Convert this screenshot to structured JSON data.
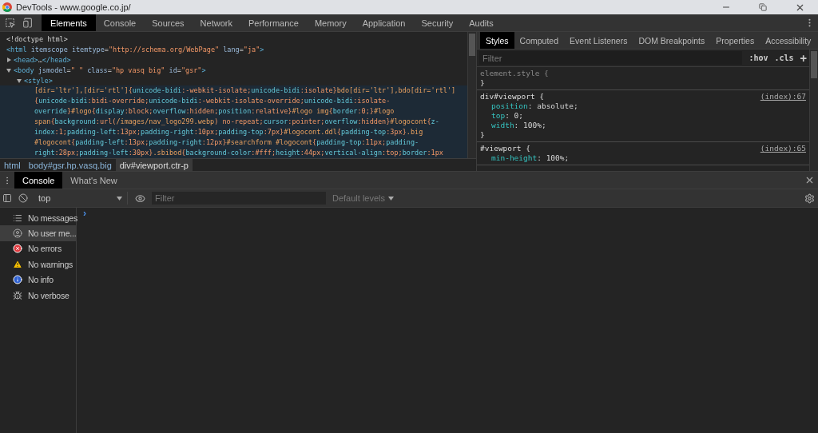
{
  "window": {
    "title": "DevTools - www.google.co.jp/"
  },
  "main_tabs": [
    {
      "label": "Elements",
      "selected": true
    },
    {
      "label": "Console",
      "selected": false
    },
    {
      "label": "Sources",
      "selected": false
    },
    {
      "label": "Network",
      "selected": false
    },
    {
      "label": "Performance",
      "selected": false
    },
    {
      "label": "Memory",
      "selected": false
    },
    {
      "label": "Application",
      "selected": false
    },
    {
      "label": "Security",
      "selected": false
    },
    {
      "label": "Audits",
      "selected": false
    }
  ],
  "dom_tree": [
    {
      "kind": "leaf",
      "segments": [
        {
          "kind": "text",
          "text": "<!doctype html>"
        }
      ]
    },
    {
      "kind": "leaf",
      "segments": [
        {
          "kind": "tag",
          "text": "<html"
        },
        {
          "kind": "attr",
          "text": " itemscope itemtype"
        },
        {
          "kind": "text",
          "text": "="
        },
        {
          "kind": "val",
          "text": "\"http://schema.org/WebPage\""
        },
        {
          "kind": "attr",
          "text": " lang"
        },
        {
          "kind": "text",
          "text": "="
        },
        {
          "kind": "val",
          "text": "\"ja\""
        },
        {
          "kind": "tag",
          "text": ">"
        }
      ]
    },
    {
      "kind": "node",
      "expanded": false,
      "segments": [
        {
          "kind": "tag",
          "text": "<head>"
        },
        {
          "kind": "text",
          "text": "…"
        },
        {
          "kind": "tag",
          "text": "</head>"
        }
      ]
    },
    {
      "kind": "node",
      "expanded": true,
      "segments": [
        {
          "kind": "tag",
          "text": "<body"
        },
        {
          "kind": "attr",
          "text": " jsmodel"
        },
        {
          "kind": "text",
          "text": "="
        },
        {
          "kind": "val",
          "text": "\" \""
        },
        {
          "kind": "attr",
          "text": " class"
        },
        {
          "kind": "text",
          "text": "="
        },
        {
          "kind": "val",
          "text": "\"hp vasq big\""
        },
        {
          "kind": "attr",
          "text": " id"
        },
        {
          "kind": "text",
          "text": "="
        },
        {
          "kind": "val",
          "text": "\"gsr\""
        },
        {
          "kind": "tag",
          "text": ">"
        }
      ],
      "children": [
        {
          "kind": "node",
          "expanded": true,
          "segments": [
            {
              "kind": "tag",
              "text": "<style>"
            }
          ],
          "children": [
            {
              "kind": "css",
              "segments": [
                {
                  "kind": "sel",
                  "text": "[dir='ltr'],[dir='rtl']"
                },
                {
                  "kind": "val",
                  "text": "{"
                },
                {
                  "kind": "prop",
                  "text": "unicode-bidi"
                },
                {
                  "kind": "val",
                  "text": ":-webkit-isolate;"
                },
                {
                  "kind": "prop",
                  "text": "unicode-bidi"
                },
                {
                  "kind": "val",
                  "text": ":isolate}"
                },
                {
                  "kind": "sel",
                  "text": "bdo[dir='ltr'],bdo[dir='rtl']"
                }
              ]
            },
            {
              "kind": "css",
              "segments": [
                {
                  "kind": "val",
                  "text": "{"
                },
                {
                  "kind": "prop",
                  "text": "unicode-bidi"
                },
                {
                  "kind": "val",
                  "text": ":bidi-override;"
                },
                {
                  "kind": "prop",
                  "text": "unicode-bidi"
                },
                {
                  "kind": "val",
                  "text": ":-webkit-isolate-override;"
                },
                {
                  "kind": "prop",
                  "text": "unicode-bidi"
                },
                {
                  "kind": "val",
                  "text": ":isolate-"
                }
              ]
            },
            {
              "kind": "css",
              "segments": [
                {
                  "kind": "prop",
                  "text": "override"
                },
                {
                  "kind": "val",
                  "text": "}"
                },
                {
                  "kind": "sel",
                  "text": "#logo"
                },
                {
                  "kind": "val",
                  "text": "{"
                },
                {
                  "kind": "prop",
                  "text": "display"
                },
                {
                  "kind": "val",
                  "text": ":block;"
                },
                {
                  "kind": "prop",
                  "text": "overflow"
                },
                {
                  "kind": "val",
                  "text": ":hidden;"
                },
                {
                  "kind": "prop",
                  "text": "position"
                },
                {
                  "kind": "val",
                  "text": ":relative}"
                },
                {
                  "kind": "sel",
                  "text": "#logo img"
                },
                {
                  "kind": "val",
                  "text": "{"
                },
                {
                  "kind": "prop",
                  "text": "border"
                },
                {
                  "kind": "val",
                  "text": ":0;}"
                },
                {
                  "kind": "sel",
                  "text": "#logo"
                }
              ]
            },
            {
              "kind": "css",
              "segments": [
                {
                  "kind": "sel",
                  "text": "span"
                },
                {
                  "kind": "val",
                  "text": "{"
                },
                {
                  "kind": "prop",
                  "text": "background"
                },
                {
                  "kind": "val",
                  "text": ":url("
                },
                {
                  "kind": "sel",
                  "text": "/images/nav_logo299.webp"
                },
                {
                  "kind": "val",
                  "text": ") no-repeat;"
                },
                {
                  "kind": "prop",
                  "text": "cursor"
                },
                {
                  "kind": "val",
                  "text": ":pointer;"
                },
                {
                  "kind": "prop",
                  "text": "overflow"
                },
                {
                  "kind": "val",
                  "text": ":hidden}"
                },
                {
                  "kind": "sel",
                  "text": "#logocont"
                },
                {
                  "kind": "val",
                  "text": "{"
                },
                {
                  "kind": "prop",
                  "text": "z-"
                }
              ]
            },
            {
              "kind": "css",
              "segments": [
                {
                  "kind": "prop",
                  "text": "index"
                },
                {
                  "kind": "val",
                  "text": ":1;"
                },
                {
                  "kind": "prop",
                  "text": "padding-left"
                },
                {
                  "kind": "val",
                  "text": ":13px;"
                },
                {
                  "kind": "prop",
                  "text": "padding-right"
                },
                {
                  "kind": "val",
                  "text": ":10px;"
                },
                {
                  "kind": "prop",
                  "text": "padding-top"
                },
                {
                  "kind": "val",
                  "text": ":7px}"
                },
                {
                  "kind": "sel",
                  "text": "#logocont.ddl"
                },
                {
                  "kind": "val",
                  "text": "{"
                },
                {
                  "kind": "prop",
                  "text": "padding-top"
                },
                {
                  "kind": "val",
                  "text": ":3px}"
                },
                {
                  "kind": "sel",
                  "text": ".big"
                }
              ]
            },
            {
              "kind": "css",
              "segments": [
                {
                  "kind": "sel",
                  "text": "#logocont"
                },
                {
                  "kind": "val",
                  "text": "{"
                },
                {
                  "kind": "prop",
                  "text": "padding-left"
                },
                {
                  "kind": "val",
                  "text": ":13px;"
                },
                {
                  "kind": "prop",
                  "text": "padding-right"
                },
                {
                  "kind": "val",
                  "text": ":12px}"
                },
                {
                  "kind": "sel",
                  "text": "#searchform #logocont"
                },
                {
                  "kind": "val",
                  "text": "{"
                },
                {
                  "kind": "prop",
                  "text": "padding-top"
                },
                {
                  "kind": "val",
                  "text": ":11px;"
                },
                {
                  "kind": "prop",
                  "text": "padding-"
                }
              ]
            },
            {
              "kind": "css",
              "segments": [
                {
                  "kind": "prop",
                  "text": "right"
                },
                {
                  "kind": "val",
                  "text": ":28px;"
                },
                {
                  "kind": "prop",
                  "text": "padding-left"
                },
                {
                  "kind": "val",
                  "text": ":30px}"
                },
                {
                  "kind": "sel",
                  "text": ".sbibod"
                },
                {
                  "kind": "val",
                  "text": "{"
                },
                {
                  "kind": "prop",
                  "text": "background-color"
                },
                {
                  "kind": "val",
                  "text": ":#fff;"
                },
                {
                  "kind": "prop",
                  "text": "height"
                },
                {
                  "kind": "val",
                  "text": ":44px;"
                },
                {
                  "kind": "prop",
                  "text": "vertical-align"
                },
                {
                  "kind": "val",
                  "text": ":top;"
                },
                {
                  "kind": "prop",
                  "text": "border"
                },
                {
                  "kind": "val",
                  "text": ":1px"
                }
              ]
            }
          ]
        }
      ]
    }
  ],
  "breadcrumbs": [
    {
      "label": "html",
      "selected": false
    },
    {
      "label": "body#gsr.hp.vasq.big",
      "selected": false
    },
    {
      "label": "div#viewport.ctr-p",
      "selected": true
    }
  ],
  "styles_tabs": [
    {
      "label": "Styles",
      "selected": true
    },
    {
      "label": "Computed",
      "selected": false
    },
    {
      "label": "Event Listeners",
      "selected": false
    },
    {
      "label": "DOM Breakpoints",
      "selected": false
    },
    {
      "label": "Properties",
      "selected": false
    },
    {
      "label": "Accessibility",
      "selected": false
    }
  ],
  "styles_filter": {
    "placeholder": "Filter"
  },
  "styles_toggles": [
    ":hov",
    ".cls",
    "+"
  ],
  "rules": [
    {
      "selector": "element.style {",
      "inline": true,
      "close": "}"
    },
    {
      "selector": "div#viewport {",
      "inline": false,
      "source": "(index):67",
      "declarations": [
        {
          "name": "position",
          "value": ": absolute;"
        },
        {
          "name": "top",
          "value": ": 0;"
        },
        {
          "name": "width",
          "value": ": 100%;"
        }
      ],
      "close": "}"
    },
    {
      "selector": "#viewport {",
      "inline": false,
      "source": "(index):65",
      "declarations": [
        {
          "name": "min-height",
          "value": ": 100%;"
        }
      ]
    }
  ],
  "drawer_tabs": [
    {
      "label": "Console",
      "selected": true
    },
    {
      "label": "What's New",
      "selected": false
    }
  ],
  "console_toolbar": {
    "context": "top",
    "filter_placeholder": "Filter",
    "levels": "Default levels"
  },
  "console_sidebar": [
    {
      "kind": "list",
      "label": "No messages",
      "selected": false
    },
    {
      "kind": "user",
      "label": "No user me...",
      "selected": true
    },
    {
      "kind": "error",
      "label": "No errors",
      "selected": false
    },
    {
      "kind": "warning",
      "label": "No warnings",
      "selected": false
    },
    {
      "kind": "info",
      "label": "No info",
      "selected": false
    },
    {
      "kind": "verbose",
      "label": "No verbose",
      "selected": false
    }
  ],
  "console_prompt": "›"
}
